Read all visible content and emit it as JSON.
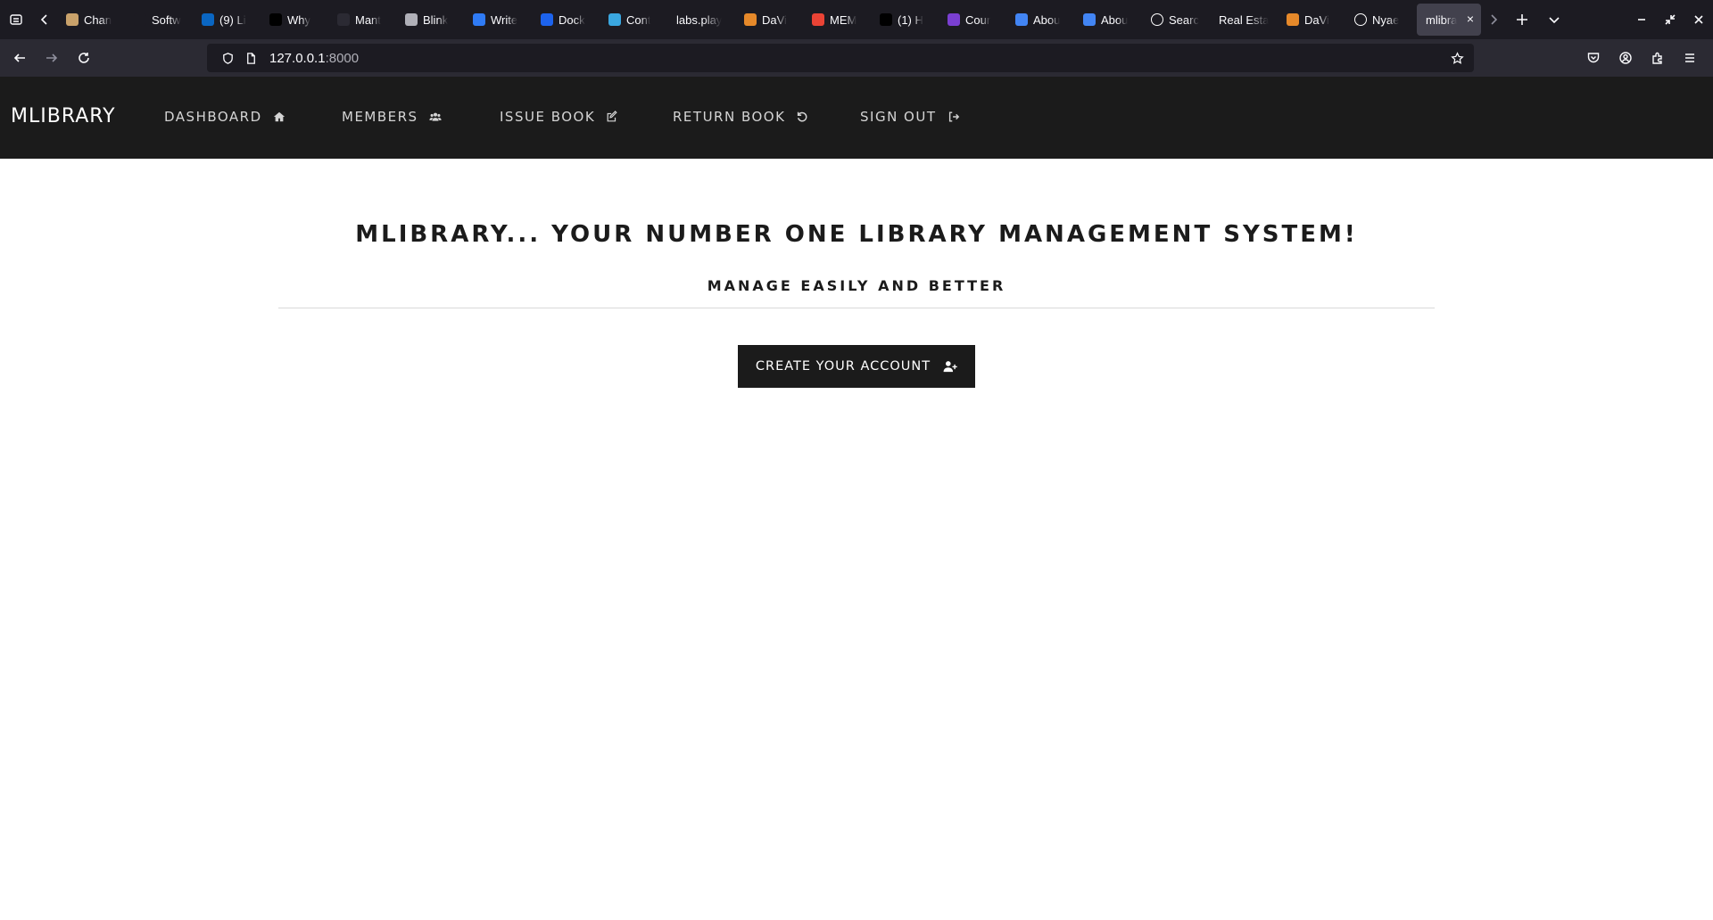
{
  "browser": {
    "tabs": [
      {
        "label": "Chan",
        "icon": "robot-icon",
        "color": "#c9a26b"
      },
      {
        "label": "Softw",
        "icon": "e-icon",
        "color": "#1c1b22"
      },
      {
        "label": "(9) Li",
        "icon": "linkedin-icon",
        "color": "#0a66c2"
      },
      {
        "label": "Why",
        "icon": "medium-icon",
        "color": "#000000"
      },
      {
        "label": "Mant",
        "icon": "dark-circle-icon",
        "color": "#2b2a33"
      },
      {
        "label": "Blink",
        "icon": "blink-icon",
        "color": "#b0b0b8"
      },
      {
        "label": "Write",
        "icon": "spiral-icon",
        "color": "#2f7bf5"
      },
      {
        "label": "Dock",
        "icon": "docker-icon",
        "color": "#1d63ed"
      },
      {
        "label": "Cont",
        "icon": "globe-icon",
        "color": "#3aa7e0"
      },
      {
        "label": "labs.play",
        "icon": "none",
        "color": "#1c1b22"
      },
      {
        "label": "DaVi",
        "icon": "davinci-icon",
        "color": "#e6892a"
      },
      {
        "label": "MEM",
        "icon": "gmail-icon",
        "color": "#ea4335"
      },
      {
        "label": "(1) H",
        "icon": "x-icon",
        "color": "#000000"
      },
      {
        "label": "Cour",
        "icon": "coursera-icon",
        "color": "#7a3fd1"
      },
      {
        "label": "Abou",
        "icon": "google-icon",
        "color": "#4285f4"
      },
      {
        "label": "Abou",
        "icon": "google-icon",
        "color": "#4285f4"
      },
      {
        "label": "Searc",
        "icon": "squarespace-icon",
        "color": "#ffffff"
      },
      {
        "label": "Real Esta",
        "icon": "none",
        "color": "#1c1b22"
      },
      {
        "label": "DaVi",
        "icon": "davinci-icon",
        "color": "#e6892a"
      },
      {
        "label": "Nyae",
        "icon": "github-icon",
        "color": "#ffffff"
      }
    ],
    "active_tab": {
      "label": "mlibra",
      "close": "×"
    },
    "url": {
      "host": "127.0.0.1",
      "port": ":8000"
    }
  },
  "site": {
    "brand": "MLIBRARY",
    "nav": [
      {
        "label": "DASHBOARD",
        "icon": "home-icon"
      },
      {
        "label": "MEMBERS",
        "icon": "users-icon"
      },
      {
        "label": "ISSUE BOOK",
        "icon": "edit-icon"
      },
      {
        "label": "RETURN BOOK",
        "icon": "undo-icon"
      },
      {
        "label": "SIGN OUT",
        "icon": "sign-out-icon"
      }
    ]
  },
  "hero": {
    "title": "MLIBRARY... YOUR NUMBER ONE LIBRARY MANAGEMENT SYSTEM!",
    "subtitle": "MANAGE EASILY AND BETTER",
    "cta_label": "CREATE YOUR ACCOUNT",
    "cta_icon": "user-plus-icon"
  },
  "colors": {
    "header_bg": "#1b1b1b",
    "button_bg": "#1b1b1b",
    "page_bg": "#ffffff",
    "tabstrip_bg": "#1c1b22"
  }
}
